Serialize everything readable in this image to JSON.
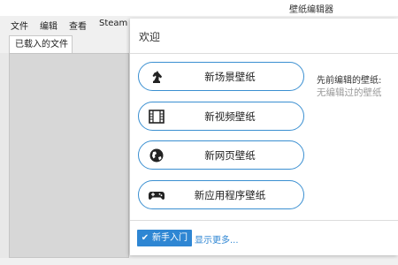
{
  "window": {
    "title": "壁纸编辑器"
  },
  "menu": [
    "文件",
    "编辑",
    "查看",
    "Steam"
  ],
  "sidebar_tab": "已载入的文件",
  "dialog": {
    "title": "欢迎",
    "actions": [
      {
        "label": "新场景壁纸",
        "icon": "chess-knight-icon"
      },
      {
        "label": "新视频壁纸",
        "icon": "film-icon"
      },
      {
        "label": "新网页壁纸",
        "icon": "globe-icon"
      },
      {
        "label": "新应用程序壁纸",
        "icon": "gamepad-icon"
      }
    ],
    "recent": {
      "title": "先前编辑的壁纸:",
      "empty": "无编辑过的壁纸"
    },
    "footer": {
      "tutorial_label": "新手入门",
      "show_more": "显示更多..."
    }
  },
  "colors": {
    "accent": "#2e86d3",
    "button_border": "#3a8fd1"
  }
}
